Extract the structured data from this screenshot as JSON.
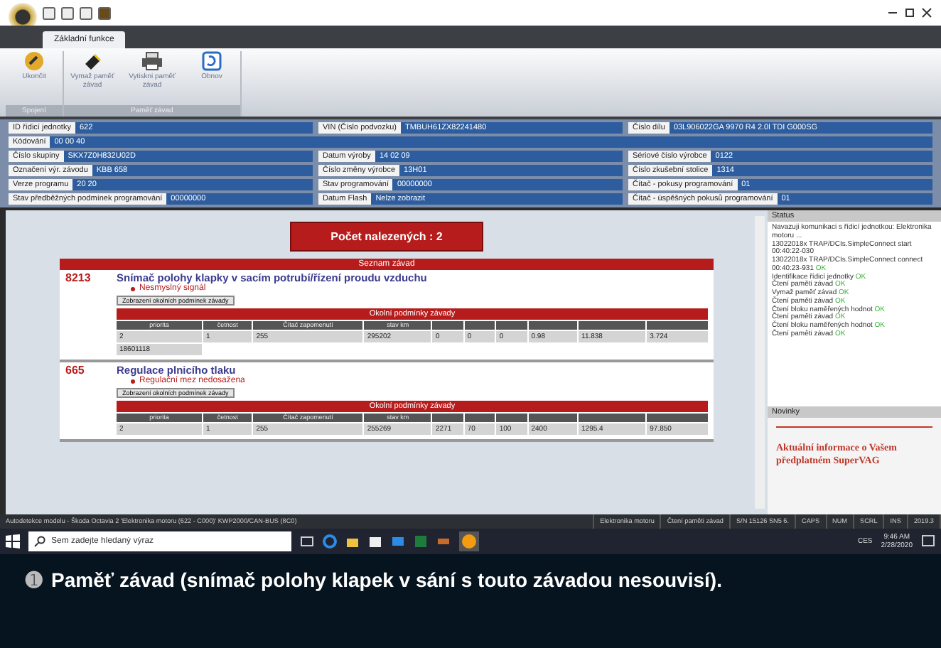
{
  "ribbon": {
    "tabs": [
      {
        "label": "Základní funkce",
        "selected": true
      }
    ],
    "groups": [
      {
        "label": "Spojení",
        "buttons": [
          {
            "label": "Ukončit",
            "kind": "link"
          }
        ]
      },
      {
        "label": "Paměť závad",
        "buttons": [
          {
            "label": "Vymaž paměť závad",
            "kind": "eraser"
          },
          {
            "label": "Vytiskni paměť závad",
            "kind": "printer"
          },
          {
            "label": "Obnov",
            "kind": "refresh"
          }
        ]
      }
    ]
  },
  "info_rows": [
    [
      {
        "label": "ID řídicí jednotky",
        "value": "622"
      },
      {
        "label": "VIN (Číslo podvozku)",
        "value": "TMBUH61ZX82241480"
      },
      {
        "label": "Číslo dílu",
        "value": "03L906022GA 9970 R4 2.0l TDI G000SG"
      }
    ],
    [
      {
        "label": "Kódování",
        "value": "00 00 40"
      }
    ],
    [
      {
        "label": "Číslo skupiny",
        "value": "SKX7Z0H832U02D"
      },
      {
        "label": "Datum výroby",
        "value": "14 02 09"
      },
      {
        "label": "Sériové číslo výrobce",
        "value": "0122"
      }
    ],
    [
      {
        "label": "Označení výr. závodu",
        "value": "KBB 658"
      },
      {
        "label": "Číslo změny výrobce",
        "value": "13H01"
      },
      {
        "label": "Číslo zkušební stolice",
        "value": "1314"
      }
    ],
    [
      {
        "label": "Verze programu",
        "value": "20      20"
      },
      {
        "label": "Stav programování",
        "value": "00000000"
      },
      {
        "label": "Čítač - pokusy programování",
        "value": "01"
      }
    ],
    [
      {
        "label": "Stav předběžných podmínek programování",
        "value": "00000000"
      },
      {
        "label": "Datum Flash",
        "value": "Nelze zobrazit"
      },
      {
        "label": "Čítač - úspěšných pokusů programování",
        "value": "01"
      }
    ]
  ],
  "results": {
    "count_label": "Počet nalezených : 2",
    "list_title": "Seznam závad",
    "faults": [
      {
        "code": "8213",
        "title": "Snímač polohy klapky v sacím potrubí/řízení proudu vzduchu",
        "details": [
          "Nesmyslný signál"
        ],
        "button": "Zobrazení okolních podmínek závady",
        "table": {
          "title": "Okolní podmínky závady",
          "columns": [
            "priorita",
            "četnost",
            "Čítač zapomenutí",
            "stav km"
          ],
          "rows": [
            [
              "2",
              "1",
              "255",
              "295202",
              "0",
              "0",
              "0",
              "0.98",
              "11.838",
              "3.724"
            ],
            [
              "18601118"
            ]
          ]
        }
      },
      {
        "code": "665",
        "title": "Regulace plnicího tlaku",
        "details": [
          "Regulační mez nedosažena"
        ],
        "button": "Zobrazení okolních podmínek závady",
        "table": {
          "title": "Okolní podmínky závady",
          "columns": [
            "priorita",
            "četnost",
            "Čítač zapomenutí",
            "stav km"
          ],
          "rows": [
            [
              "2",
              "1",
              "255",
              "255269",
              "2271",
              "70",
              "100",
              "2400",
              "1295.4",
              "97.850"
            ]
          ]
        }
      }
    ]
  },
  "status_panel": {
    "title": "Status",
    "lines": [
      {
        "text": "Navazuji komunikaci s řídicí jednotkou: Elektronika motoru ..."
      },
      {
        "text": "13022018x TRAP/DCIs.SimpleConnect start 00:40:22-030"
      },
      {
        "text": "13022018x TRAP/DCIs.SimpleConnect connect 00:40:23-931",
        "ok": "OK"
      },
      {
        "text": "Identifikace řídicí jednotky",
        "ok": "OK"
      },
      {
        "text": "Čtení paměti závad",
        "ok": "OK"
      },
      {
        "text": "Vymaž paměť závad",
        "ok": "OK"
      },
      {
        "text": "Čtení paměti závad",
        "ok": "OK"
      },
      {
        "text": "Čtení bloku naměřených hodnot",
        "ok": "OK"
      },
      {
        "text": "Čtení paměti závad",
        "ok": "OK"
      },
      {
        "text": "Čtení bloku naměřených hodnot",
        "ok": "OK"
      },
      {
        "text": "Čtení paměti závad",
        "ok": "OK"
      }
    ]
  },
  "news_panel": {
    "title": "Novinky",
    "text": "Aktuální informace o Vašem předplatném SuperVAG"
  },
  "status_bar": [
    "Autodetekce modelu - Škoda Octavia 2 'Elektronika motoru (622 - C000)' KWP2000/CAN-BUS (8C0)",
    "Elektronika motoru",
    "Čtení paměti závad",
    "S/N 15126 SN5 6.",
    "CAPS",
    "NUM",
    "SCRL",
    "INS",
    "2019.3"
  ],
  "taskbar": {
    "search_placeholder": "Sem zadejte hledaný výraz",
    "language": "CES",
    "time": "9:46 AM",
    "date": "2/28/2020"
  },
  "caption": {
    "marker": "➊",
    "text": "Paměť závad (snímač polohy klapek v sání s touto závadou nesouvisí)."
  }
}
